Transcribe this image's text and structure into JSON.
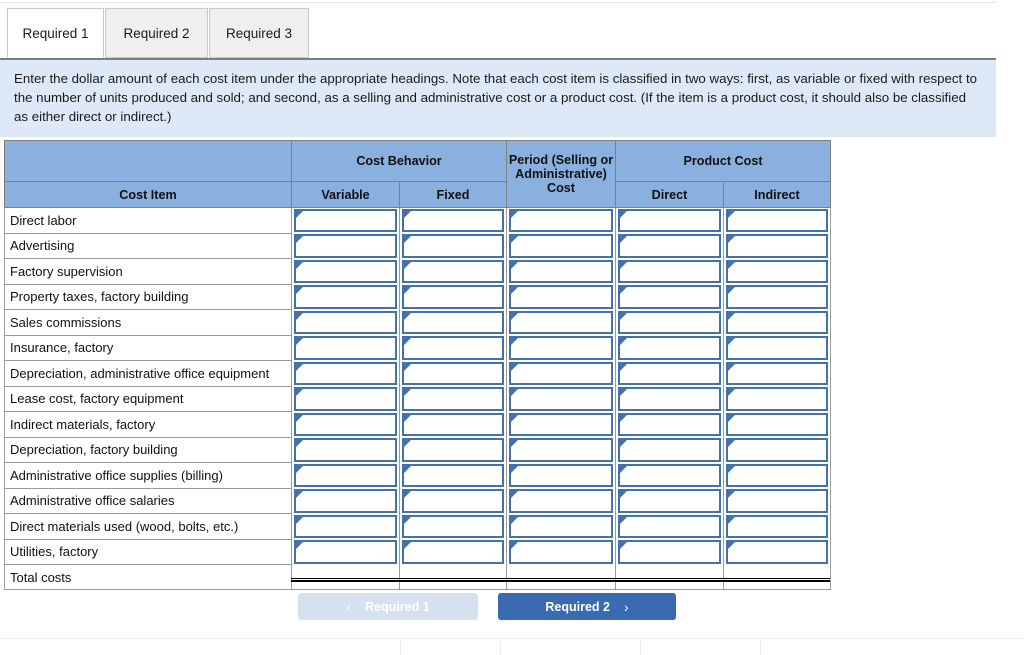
{
  "tabs": [
    {
      "label": "Required 1",
      "active": true
    },
    {
      "label": "Required 2",
      "active": false
    },
    {
      "label": "Required 3",
      "active": false
    }
  ],
  "instructions": "Enter the dollar amount of each cost item under the appropriate headings. Note that each cost item is classified in two ways: first, as variable or fixed with respect to the number of units produced and sold; and second, as a selling and administrative cost or a product cost. (If the item is a product cost, it should also be classified as either direct or indirect.)",
  "table": {
    "group_headers": {
      "cost_item": "Cost Item",
      "cost_behavior": "Cost Behavior",
      "period_cost": "Period (Selling or Administrative) Cost",
      "product_cost": "Product Cost"
    },
    "sub_headers": {
      "variable": "Variable",
      "fixed": "Fixed",
      "direct": "Direct",
      "indirect": "Indirect"
    },
    "rows": [
      {
        "label": "Direct labor",
        "inputs": true
      },
      {
        "label": "Advertising",
        "inputs": true
      },
      {
        "label": "Factory supervision",
        "inputs": true
      },
      {
        "label": "Property taxes, factory building",
        "inputs": true
      },
      {
        "label": "Sales commissions",
        "inputs": true
      },
      {
        "label": "Insurance, factory",
        "inputs": true
      },
      {
        "label": "Depreciation, administrative office equipment",
        "inputs": true
      },
      {
        "label": "Lease cost, factory equipment",
        "inputs": true
      },
      {
        "label": "Indirect materials, factory",
        "inputs": true
      },
      {
        "label": "Depreciation, factory building",
        "inputs": true
      },
      {
        "label": "Administrative office supplies (billing)",
        "inputs": true
      },
      {
        "label": "Administrative office salaries",
        "inputs": true
      },
      {
        "label": "Direct materials used (wood, bolts, etc.)",
        "inputs": true
      },
      {
        "label": "Utilities, factory",
        "inputs": true
      },
      {
        "label": "Total costs",
        "inputs": false
      }
    ]
  },
  "nav": {
    "prev_label": "Required 1",
    "next_label": "Required 2",
    "prev_chevron": "‹",
    "next_chevron": "›"
  },
  "colors": {
    "header_blue": "#8ab0e0",
    "banner_blue": "#dde9f7",
    "input_border": "#4472a8",
    "next_button": "#3a6bb0",
    "prev_button": "#d6e0ef"
  }
}
